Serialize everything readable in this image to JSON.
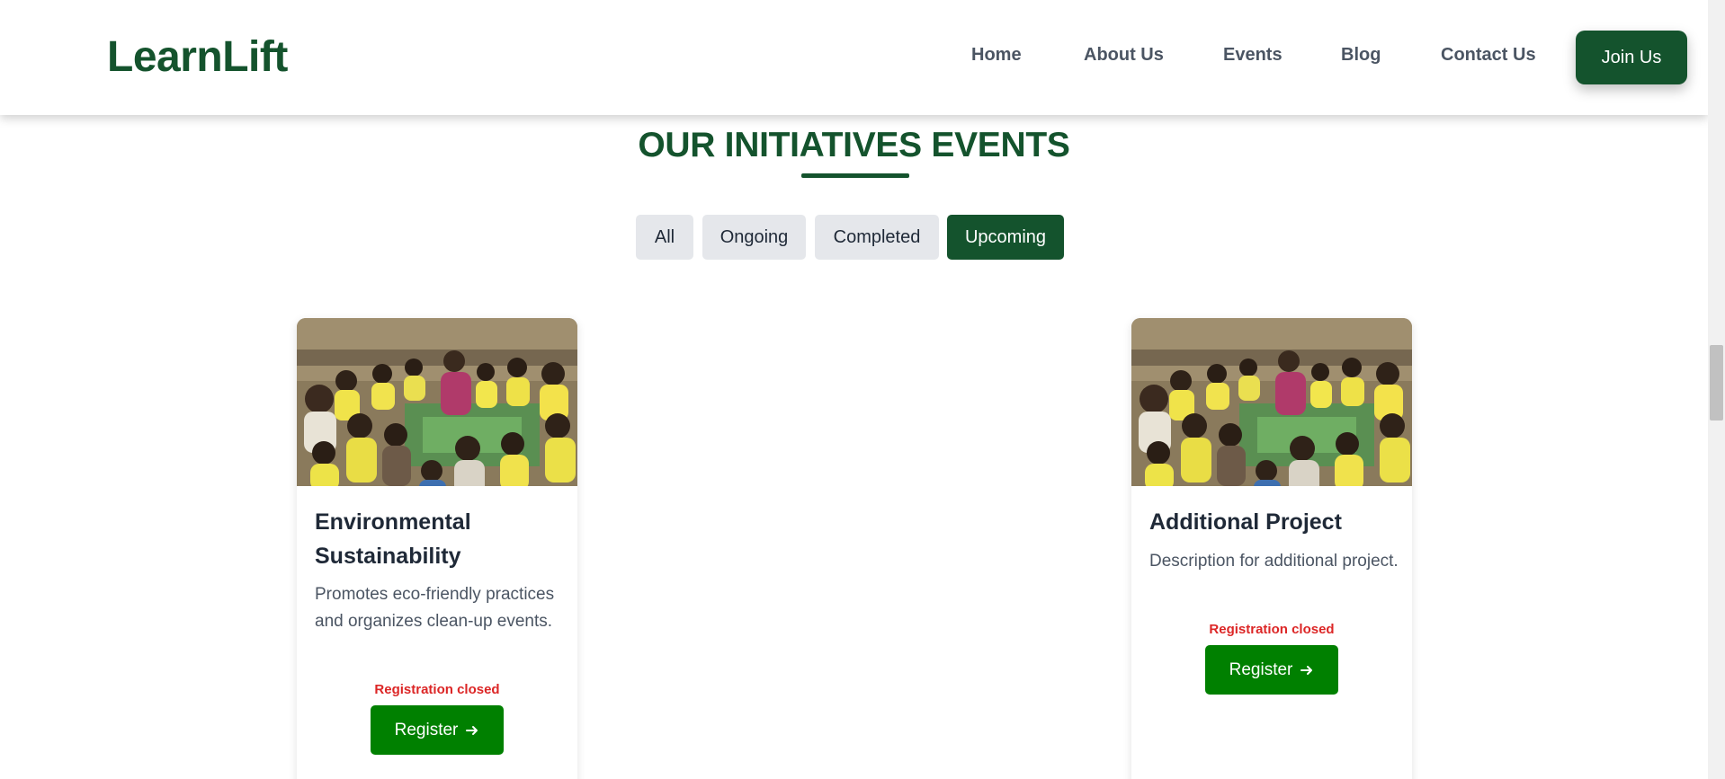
{
  "header": {
    "logo": "LearnLift",
    "nav": [
      "Home",
      "About Us",
      "Events",
      "Blog",
      "Contact Us"
    ],
    "cta": "Join Us"
  },
  "section": {
    "title": "OUR INITIATIVES EVENTS"
  },
  "filters": [
    {
      "label": "All",
      "active": false
    },
    {
      "label": "Ongoing",
      "active": false
    },
    {
      "label": "Completed",
      "active": false
    },
    {
      "label": "Upcoming",
      "active": true
    }
  ],
  "cards": [
    {
      "title": "Environmental Sustainability",
      "description": "Promotes eco-friendly practices and organizes clean-up events.",
      "status": "Registration closed",
      "button": "Register"
    },
    {
      "title": "Additional Project",
      "description": "Description for additional project.",
      "status": "Registration closed",
      "button": "Register"
    }
  ],
  "colors": {
    "brand": "#14532d",
    "register": "#008000",
    "closed": "#dc2626",
    "filter_bg": "#e5e7eb"
  },
  "icons": {
    "register_arrow": "arrow-right-icon"
  }
}
